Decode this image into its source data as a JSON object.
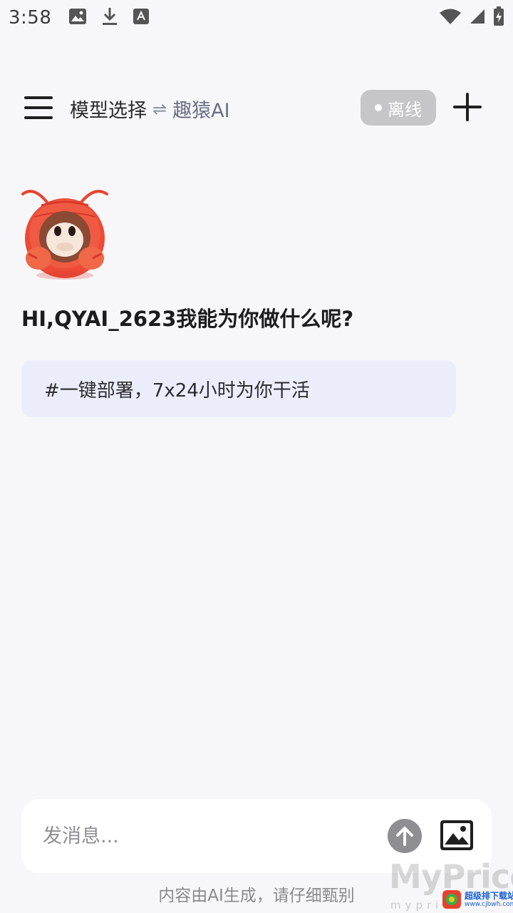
{
  "status_bar": {
    "time": "3:58",
    "left_icons": [
      "image-icon",
      "download-icon",
      "text-a-icon"
    ],
    "right_icons": [
      "wifi-icon",
      "signal-icon",
      "battery-charging-icon"
    ]
  },
  "header": {
    "model_label": "模型选择",
    "swap_symbol": "⇌",
    "model_name": "趣猿AI",
    "status": "离线"
  },
  "greeting": "HI,QYAI_2623我能为你做什么呢?",
  "suggestion": "#一键部署，7x24小时为你干活",
  "input": {
    "placeholder": "发消息..."
  },
  "disclaimer": "内容由AI生成，请仔细甄别",
  "watermark": {
    "brand": "MyPrice",
    "brand_sub": "mypric",
    "badge_title": "超级排下载站",
    "badge_url": "www.cjbwh.com"
  },
  "colors": {
    "background": "#f7f7f9",
    "suggestion_bg": "#ebeefa",
    "status_pill": "#c6c6c8",
    "send_button": "#8f8f91",
    "mascot_red": "#ec4a36"
  }
}
